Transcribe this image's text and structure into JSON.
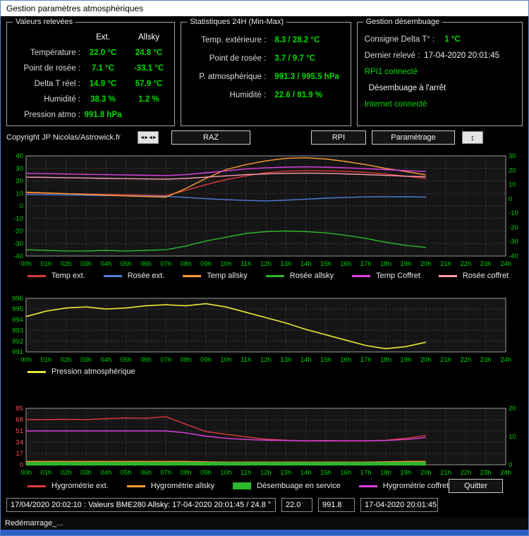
{
  "window": {
    "title": "Gestion paramètres atmosphériques"
  },
  "taskbar": {
    "item": "Redémarrage_..."
  },
  "panels": {
    "valeurs": {
      "title": "Valeurs relevées",
      "col_ext": "Ext.",
      "col_allsky": "Allsky",
      "rows": [
        {
          "label": "Température :",
          "ext": "22.0 °C",
          "allsky": "24.8 °C"
        },
        {
          "label": "Point de rosée :",
          "ext": "7.1 °C",
          "allsky": "-33.1 °C"
        },
        {
          "label": "Delta T réel :",
          "ext": "14.9 °C",
          "allsky": "57.9 °C"
        },
        {
          "label": "Humidité :",
          "ext": "38.3 %",
          "allsky": "1.2 %"
        },
        {
          "label": "Pression atmo :",
          "ext": "991.8 hPa",
          "allsky": ""
        }
      ]
    },
    "stats": {
      "title": "Statistiques 24H (Min-Max)",
      "rows": [
        {
          "label": "Temp. extérieure :",
          "value": "8.3 / 28.2 °C"
        },
        {
          "label": "Point de rosée :",
          "value": "3.7 / 9.7 °C"
        },
        {
          "label": "P. atmosphérique :",
          "value": "991.3 / 995.5 hPa"
        },
        {
          "label": "Humidité :",
          "value": "22.6 / 81.9 %"
        }
      ]
    },
    "desembuage": {
      "title": "Gestion désembuage",
      "consigne_label": "Consigne Delta T° :",
      "consigne_value": "1 °C",
      "releve_label": "Dernier relevé :",
      "releve_value": "17-04-2020 20:01:45",
      "rpi_status": "RPI1 connecté",
      "etat": "Désembuage à l'arrêt",
      "internet_status": "Internet connecté"
    }
  },
  "toolbar": {
    "copyright": "Copyright JP Nicolas/Astrowick.fr",
    "mini1_glyph": "◄►◄►",
    "raz": "RAZ",
    "rpi": "RPI",
    "parametrage": "Paramétrage",
    "mini2_glyph": "↕"
  },
  "statusbar": {
    "message": "17/04/2020 20:02:10 : Valeurs BME280 Allsky: 17-04-2020 20:01:45 / 24.8 °",
    "temperature": "22.0",
    "pression": "991.8",
    "horodatage": "17-04-2020 20:01:45"
  },
  "buttons": {
    "quitter": "Quitter"
  },
  "colors": {
    "value_green": "#00dd00",
    "axis_green": "#00d200",
    "axis_red": "#ff4d4d",
    "titlebar_bg": "#ffffff",
    "window_border": "#5d82c1"
  },
  "shared": {
    "x_tick_labels": [
      "00h",
      "01h",
      "02h",
      "03h",
      "04h",
      "05h",
      "06h",
      "07h",
      "08h",
      "09h",
      "10h",
      "11h",
      "12h",
      "13h",
      "14h",
      "15h",
      "16h",
      "17h",
      "18h",
      "19h",
      "20h",
      "21h",
      "22h",
      "23h",
      "24h"
    ]
  },
  "chart_data": [
    {
      "name": "temperatures",
      "type": "line",
      "xlim": [
        0,
        24
      ],
      "ylim": [
        -40,
        40
      ],
      "y_ticks": [
        40,
        30,
        20,
        10,
        0,
        -10,
        -20,
        -30,
        -40
      ],
      "y_axis_color": "#00d200",
      "right_ylim": [
        -40,
        30
      ],
      "right_ticks": [
        30,
        20,
        10,
        0,
        -10,
        -20,
        -30,
        -40
      ],
      "right_axis_color": "#00d200",
      "x_axis_color": "#00d200",
      "x": [
        0,
        1,
        2,
        3,
        4,
        5,
        6,
        7,
        8,
        9,
        10,
        11,
        12,
        13,
        14,
        15,
        16,
        17,
        18,
        19,
        20
      ],
      "series": [
        {
          "name": "Temp ext.",
          "color": "#e03a3a",
          "values": [
            10.5,
            10.2,
            9.8,
            9.5,
            9.2,
            8.9,
            8.6,
            8.3,
            12.5,
            17.0,
            21.0,
            24.0,
            26.5,
            27.8,
            28.2,
            28.0,
            27.6,
            26.8,
            25.5,
            23.8,
            22.0
          ]
        },
        {
          "name": "Rosée ext.",
          "color": "#4f7fd9",
          "values": [
            9.2,
            9.0,
            8.8,
            8.5,
            8.3,
            8.1,
            7.9,
            7.7,
            6.8,
            5.8,
            5.0,
            4.4,
            4.0,
            4.6,
            5.4,
            6.2,
            6.8,
            7.2,
            7.4,
            7.3,
            7.1
          ]
        },
        {
          "name": "Temp allsky",
          "color": "#ff9d2e",
          "values": [
            11.0,
            10.4,
            9.8,
            9.2,
            8.6,
            8.0,
            7.5,
            7.0,
            14.0,
            22.0,
            29.0,
            33.0,
            36.0,
            38.0,
            38.5,
            37.5,
            35.5,
            33.0,
            30.0,
            27.5,
            24.8
          ]
        },
        {
          "name": "Rosée allsky",
          "color": "#2db82d",
          "values": [
            -35.0,
            -35.5,
            -36.0,
            -36.0,
            -35.5,
            -36.0,
            -35.5,
            -35.0,
            -32.0,
            -28.0,
            -25.0,
            -22.0,
            -20.5,
            -20.0,
            -20.5,
            -21.5,
            -23.5,
            -26.0,
            -29.0,
            -31.5,
            -33.1
          ]
        },
        {
          "name": "Temp Coffret",
          "color": "#e040e0",
          "values": [
            26.0,
            25.8,
            25.5,
            25.2,
            25.0,
            24.8,
            24.5,
            24.3,
            25.0,
            26.5,
            28.0,
            29.5,
            30.5,
            31.0,
            31.2,
            31.0,
            30.5,
            29.8,
            29.0,
            28.2,
            27.5
          ]
        },
        {
          "name": "Rosée coffret",
          "color": "#ff9eae",
          "values": [
            23.0,
            22.8,
            22.5,
            22.3,
            22.0,
            21.8,
            21.6,
            21.4,
            22.0,
            23.0,
            24.0,
            25.0,
            25.6,
            26.0,
            26.2,
            26.0,
            25.6,
            25.0,
            24.4,
            23.8,
            23.3
          ]
        }
      ]
    },
    {
      "name": "pression",
      "type": "line",
      "xlim": [
        0,
        24
      ],
      "ylim": [
        991,
        996
      ],
      "y_ticks": [
        996,
        995,
        994,
        993,
        992,
        991
      ],
      "y_axis_color": "#00d200",
      "x_axis_color": "#00d200",
      "x": [
        0,
        1,
        2,
        3,
        4,
        5,
        6,
        7,
        8,
        9,
        10,
        11,
        12,
        13,
        14,
        15,
        16,
        17,
        18,
        19,
        20
      ],
      "series": [
        {
          "name": "Pression atmosphérique",
          "color": "#e8e834",
          "width": 1.6,
          "values": [
            994.3,
            994.8,
            995.1,
            995.2,
            995.0,
            995.1,
            995.3,
            995.4,
            995.3,
            995.5,
            995.2,
            994.7,
            994.2,
            993.7,
            993.1,
            992.6,
            992.1,
            991.6,
            991.3,
            991.5,
            991.9
          ]
        }
      ]
    },
    {
      "name": "hygrometrie",
      "type": "line",
      "xlim": [
        0,
        24
      ],
      "ylim": [
        0,
        85
      ],
      "y_ticks": [
        85,
        68,
        51,
        34,
        17,
        0
      ],
      "y_axis_color": "#ff4d4d",
      "right_ylim": [
        0,
        20
      ],
      "right_ticks": [
        20,
        10,
        0
      ],
      "right_axis_color": "#00d200",
      "x_axis_color": "#00d200",
      "x": [
        0,
        1,
        2,
        3,
        4,
        5,
        6,
        7,
        8,
        9,
        10,
        11,
        12,
        13,
        14,
        15,
        16,
        17,
        18,
        19,
        20
      ],
      "series": [
        {
          "name": "Hygrométrie ext.",
          "color": "#e03a3a",
          "values": [
            68,
            68,
            68.5,
            68,
            69.5,
            70.5,
            70,
            72.5,
            61,
            50,
            46,
            42,
            38.5,
            37,
            36,
            36.5,
            36,
            36,
            37,
            40,
            44
          ]
        },
        {
          "name": "Hygrométrie allsky",
          "color": "#ff9d2e",
          "values": [
            5,
            5,
            5,
            5,
            5,
            5,
            5,
            5,
            5,
            4.5,
            4,
            4,
            4,
            4,
            4,
            4,
            4,
            4,
            4.5,
            5,
            5
          ]
        },
        {
          "name": "Désembuage en service",
          "color": "#2db82d",
          "block": true,
          "width": 5,
          "values": [
            1.5,
            1.5,
            1.5,
            1.5,
            1.5,
            1.5,
            1.5,
            1.5,
            1.5,
            1.5,
            1.5,
            1.5,
            1.5,
            1.5,
            1.5,
            1.5,
            1.5,
            1.5,
            1.5,
            1.5,
            1.5
          ]
        },
        {
          "name": "Hygrométrie coffret",
          "color": "#e040e0",
          "values": [
            51,
            51,
            51,
            51,
            51,
            51,
            51,
            51,
            48,
            43,
            40,
            38,
            37,
            36.5,
            36,
            36,
            36,
            36,
            36.5,
            38,
            41
          ]
        }
      ]
    }
  ]
}
